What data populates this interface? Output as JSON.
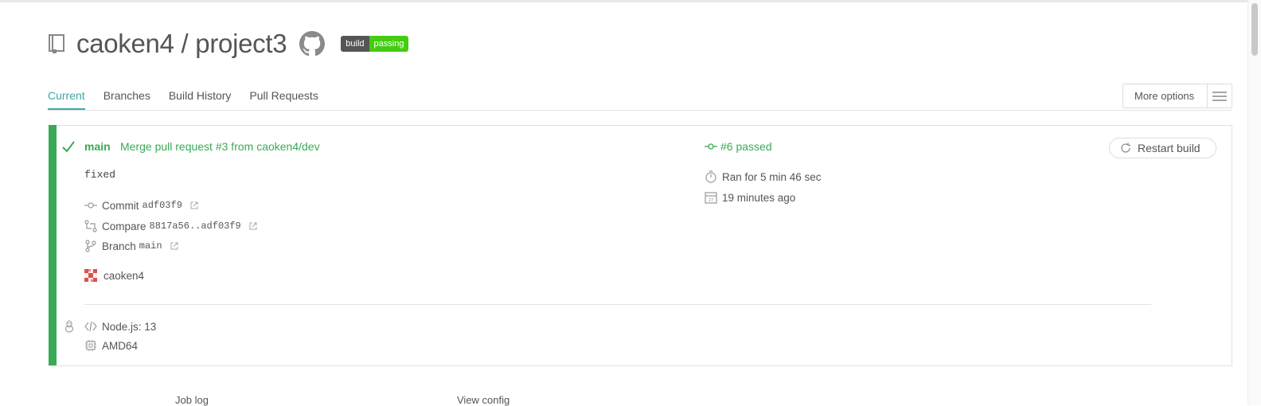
{
  "repo": {
    "title": "caoken4 / project3"
  },
  "badge": {
    "left": "build",
    "right": "passing"
  },
  "tabs": [
    "Current",
    "Branches",
    "Build History",
    "Pull Requests"
  ],
  "more_options": {
    "label": "More options"
  },
  "build": {
    "branch": "main",
    "commit_message": "Merge pull request #3 from caoken4/dev",
    "description": "fixed",
    "commit": {
      "label": "Commit",
      "hash": "adf03f9"
    },
    "compare": {
      "label": "Compare",
      "range": "8817a56..adf03f9"
    },
    "branch_link": {
      "label": "Branch",
      "name": "main"
    },
    "author": "caoken4",
    "status": "#6 passed",
    "duration": "Ran for 5 min 46 sec",
    "finished": "19 minutes ago",
    "restart_label": "Restart build",
    "language": "Node.js: 13",
    "arch": "AMD64"
  },
  "bottom_tabs": {
    "job_log": "Job log",
    "view_config": "View config"
  },
  "colors": {
    "passed": "#39aa56",
    "accent": "#3ba7a7"
  },
  "icons": [
    "repo-icon",
    "github-icon",
    "check-icon",
    "commit-icon",
    "compare-icon",
    "branch-icon",
    "external-link-icon",
    "stopwatch-icon",
    "calendar-icon",
    "restart-icon",
    "code-icon",
    "cpu-icon",
    "linux-icon",
    "hamburger-icon"
  ]
}
